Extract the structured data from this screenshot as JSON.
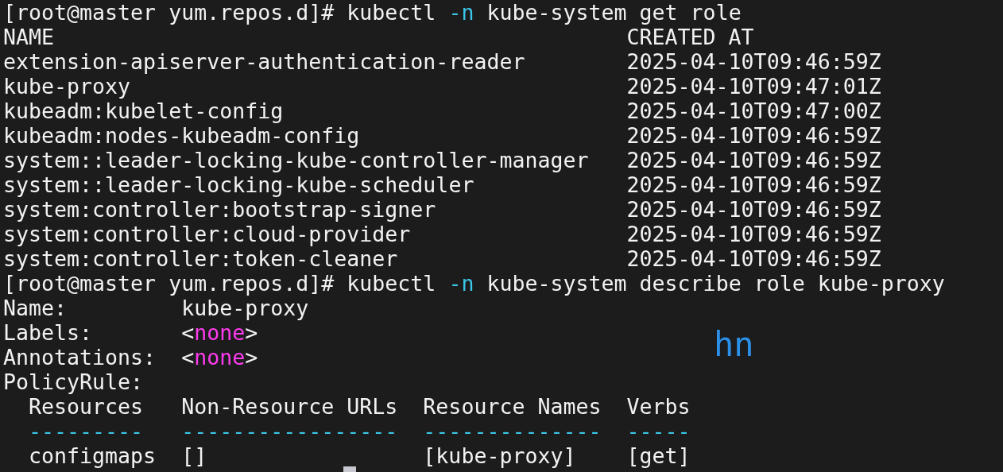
{
  "blocks": [
    {
      "kind": "command",
      "prompt": "[root@master yum.repos.d]# ",
      "parts": [
        {
          "text": "kubectl ",
          "kind": "plain"
        },
        {
          "text": "-n",
          "kind": "flag"
        },
        {
          "text": " kube-system get role",
          "kind": "plain"
        }
      ]
    },
    {
      "kind": "table",
      "columns": [
        "NAME",
        "CREATED AT"
      ],
      "rows": [
        [
          "extension-apiserver-authentication-reader",
          "2025-04-10T09:46:59Z"
        ],
        [
          "kube-proxy",
          "2025-04-10T09:47:01Z"
        ],
        [
          "kubeadm:kubelet-config",
          "2025-04-10T09:47:00Z"
        ],
        [
          "kubeadm:nodes-kubeadm-config",
          "2025-04-10T09:46:59Z"
        ],
        [
          "system::leader-locking-kube-controller-manager",
          "2025-04-10T09:46:59Z"
        ],
        [
          "system::leader-locking-kube-scheduler",
          "2025-04-10T09:46:59Z"
        ],
        [
          "system:controller:bootstrap-signer",
          "2025-04-10T09:46:59Z"
        ],
        [
          "system:controller:cloud-provider",
          "2025-04-10T09:46:59Z"
        ],
        [
          "system:controller:token-cleaner",
          "2025-04-10T09:46:59Z"
        ]
      ]
    },
    {
      "kind": "command",
      "prompt": "[root@master yum.repos.d]# ",
      "parts": [
        {
          "text": "kubectl ",
          "kind": "plain"
        },
        {
          "text": "-n",
          "kind": "flag"
        },
        {
          "text": " kube-system describe role kube-proxy",
          "kind": "plain"
        }
      ]
    },
    {
      "kind": "fields",
      "fields": [
        {
          "label": "Name:",
          "value": [
            {
              "text": "kube-proxy",
              "kind": "plain"
            }
          ]
        },
        {
          "label": "Labels:",
          "value": [
            {
              "text": "<",
              "kind": "plain"
            },
            {
              "text": "none",
              "kind": "keyword"
            },
            {
              "text": ">",
              "kind": "plain"
            }
          ]
        },
        {
          "label": "Annotations:",
          "value": [
            {
              "text": "<",
              "kind": "plain"
            },
            {
              "text": "none",
              "kind": "keyword"
            },
            {
              "text": ">",
              "kind": "plain"
            }
          ]
        },
        {
          "label": "PolicyRule:"
        }
      ]
    },
    {
      "kind": "rules",
      "columns": [
        "Resources",
        "Non-Resource URLs",
        "Resource Names",
        "Verbs"
      ],
      "dashes": [
        "---------",
        "-----------------",
        "--------------",
        "-----"
      ],
      "rows": [
        [
          "configmaps",
          "[]",
          "[kube-proxy]",
          "[get]"
        ]
      ]
    }
  ],
  "overlay": "hn"
}
